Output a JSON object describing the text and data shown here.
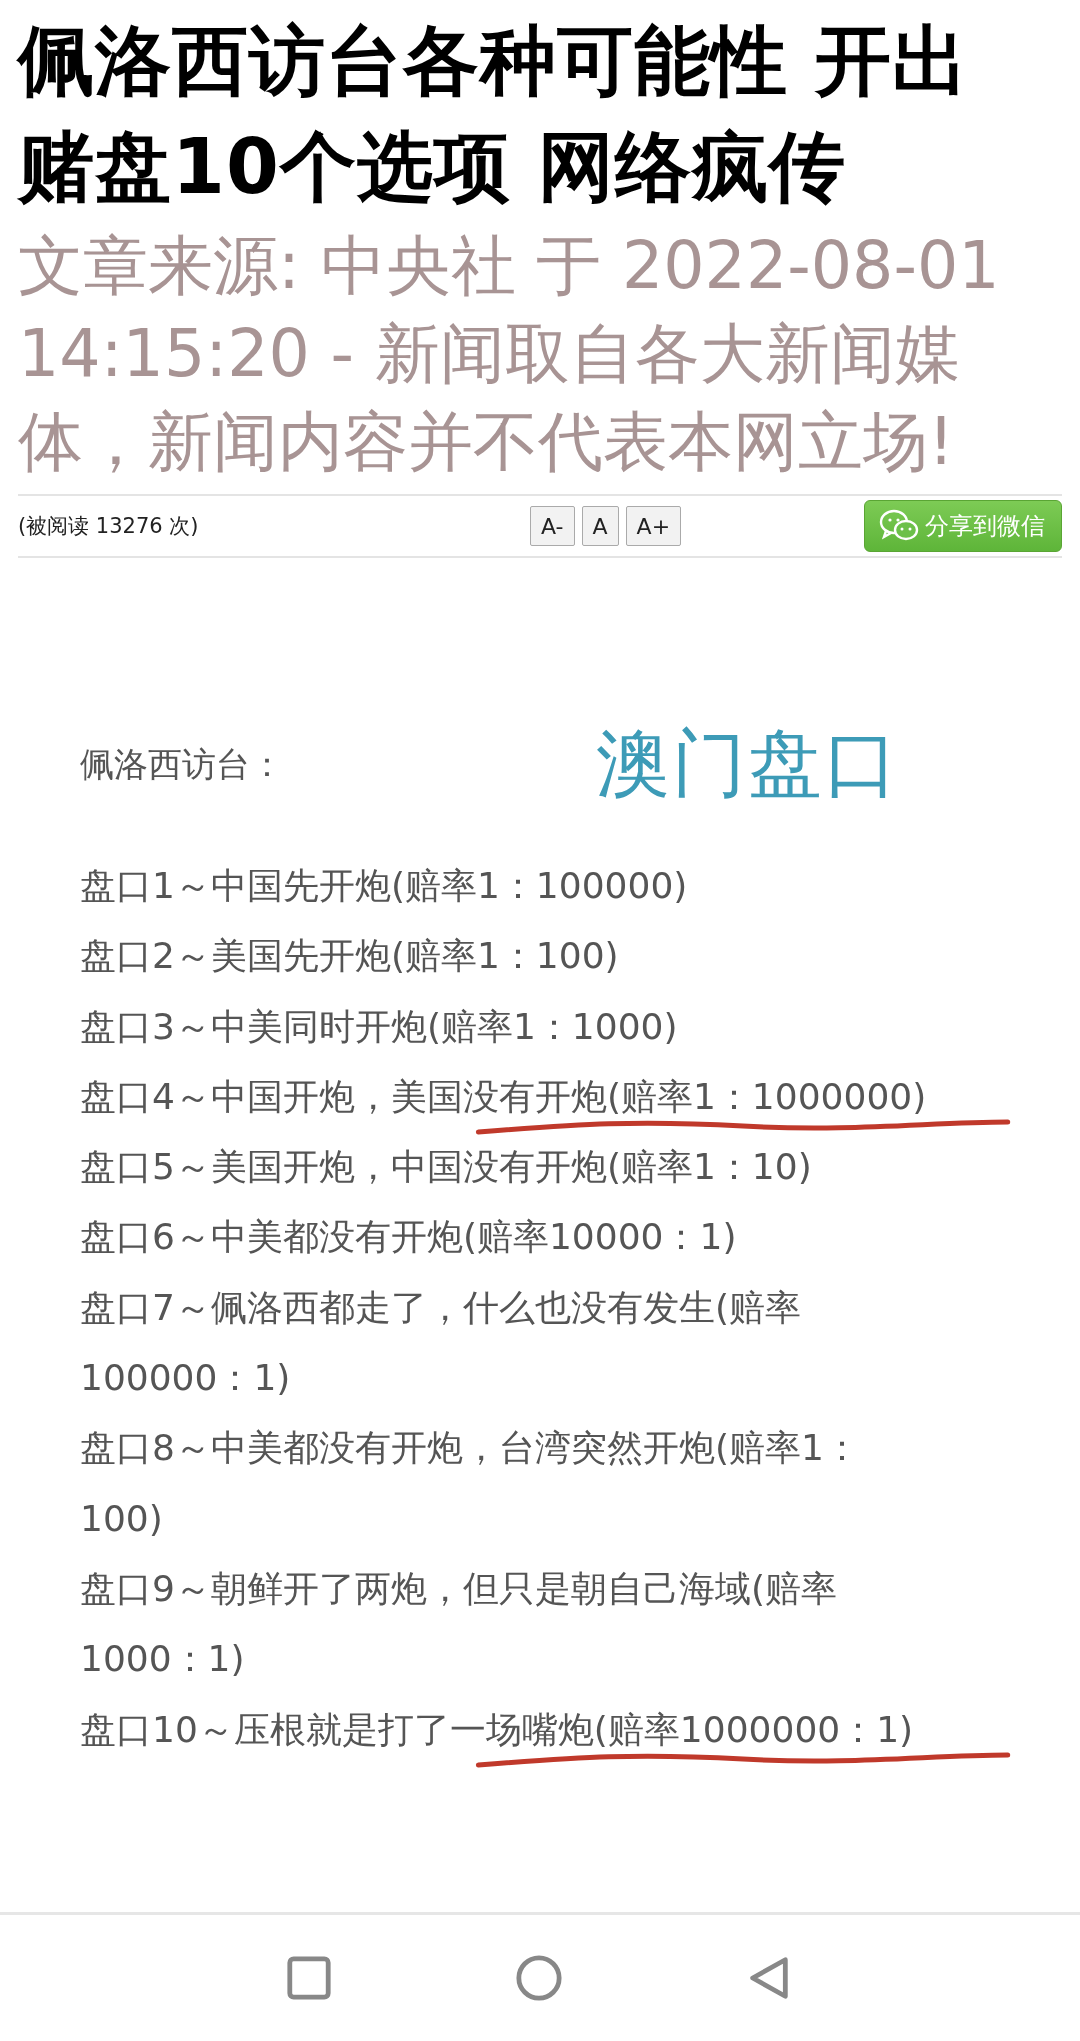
{
  "article": {
    "title": "佩洛西访台各种可能性 开出赌盘10个选项 网络疯传",
    "source": "文章来源: 中央社 于 2022-08-01 14:15:20 - 新闻取自各大新闻媒体，新闻内容并不代表本网立场!"
  },
  "meta": {
    "views": "(被阅读 13276 次)",
    "font_buttons": [
      "A-",
      "A",
      "A+"
    ],
    "share": "分享到微信"
  },
  "image": {
    "heading": "佩洛西访台：",
    "stamp": "澳门盘口",
    "options": [
      {
        "text": "盘口1～中国先开炮(赔率1：100000)",
        "underlined": false
      },
      {
        "text": "盘口2～美国先开炮(赔率1：100)",
        "underlined": false
      },
      {
        "text": "盘口3～中美同时开炮(赔率1：1000)",
        "underlined": false
      },
      {
        "text": "盘口4～中国开炮，美国没有开炮(赔率1：1000000)",
        "underlined": true
      },
      {
        "text": "盘口5～美国开炮，中国没有开炮(赔率1：10)",
        "underlined": false
      },
      {
        "text": "盘口6～中美都没有开炮(赔率10000：1)",
        "underlined": false
      },
      {
        "text": "盘口7～佩洛西都走了，什么也没有发生(赔率\n100000：1)",
        "underlined": false
      },
      {
        "text": "盘口8～中美都没有开炮，台湾突然开炮(赔率1：\n100)",
        "underlined": false
      },
      {
        "text": "盘口9～朝鲜开了两炮，但只是朝自己海域(赔率\n1000：1)",
        "underlined": false
      },
      {
        "text": "盘口10～压根就是打了一场嘴炮(赔率1000000：1)",
        "underlined": true
      }
    ]
  }
}
